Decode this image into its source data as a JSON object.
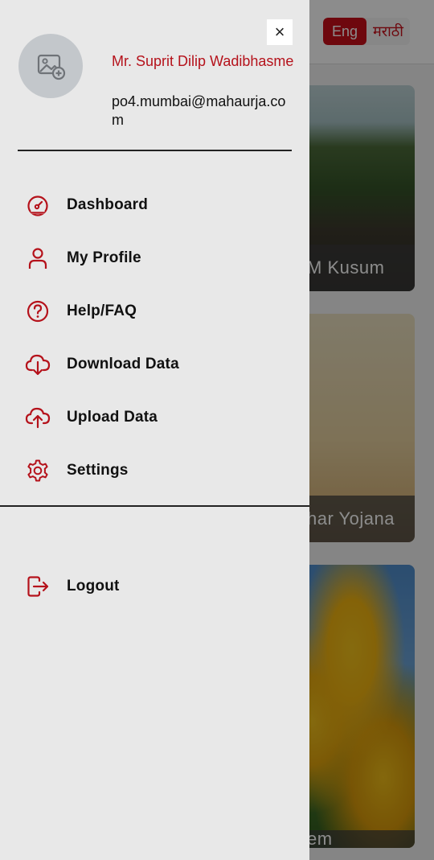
{
  "background": {
    "language": {
      "active": "Eng",
      "inactive": "मराठी"
    },
    "cards": [
      {
        "caption": "M Kusum"
      },
      {
        "caption": "har Yojana"
      },
      {
        "caption": "em"
      }
    ]
  },
  "drawer": {
    "close_label": "×",
    "user": {
      "name": "Mr. Suprit Dilip Wadibhasme",
      "email": "po4.mumbai@mahaurja.com"
    },
    "menu": [
      {
        "label": "Dashboard",
        "icon": "dashboard-gauge-icon"
      },
      {
        "label": "My Profile",
        "icon": "user-icon"
      },
      {
        "label": "Help/FAQ",
        "icon": "help-icon"
      },
      {
        "label": "Download Data",
        "icon": "cloud-download-icon"
      },
      {
        "label": "Upload Data",
        "icon": "cloud-upload-icon"
      },
      {
        "label": "Settings",
        "icon": "gear-icon"
      }
    ],
    "logout": {
      "label": "Logout",
      "icon": "logout-icon"
    }
  },
  "colors": {
    "accent": "#b5121b",
    "drawer_bg": "#e8e8e8"
  }
}
